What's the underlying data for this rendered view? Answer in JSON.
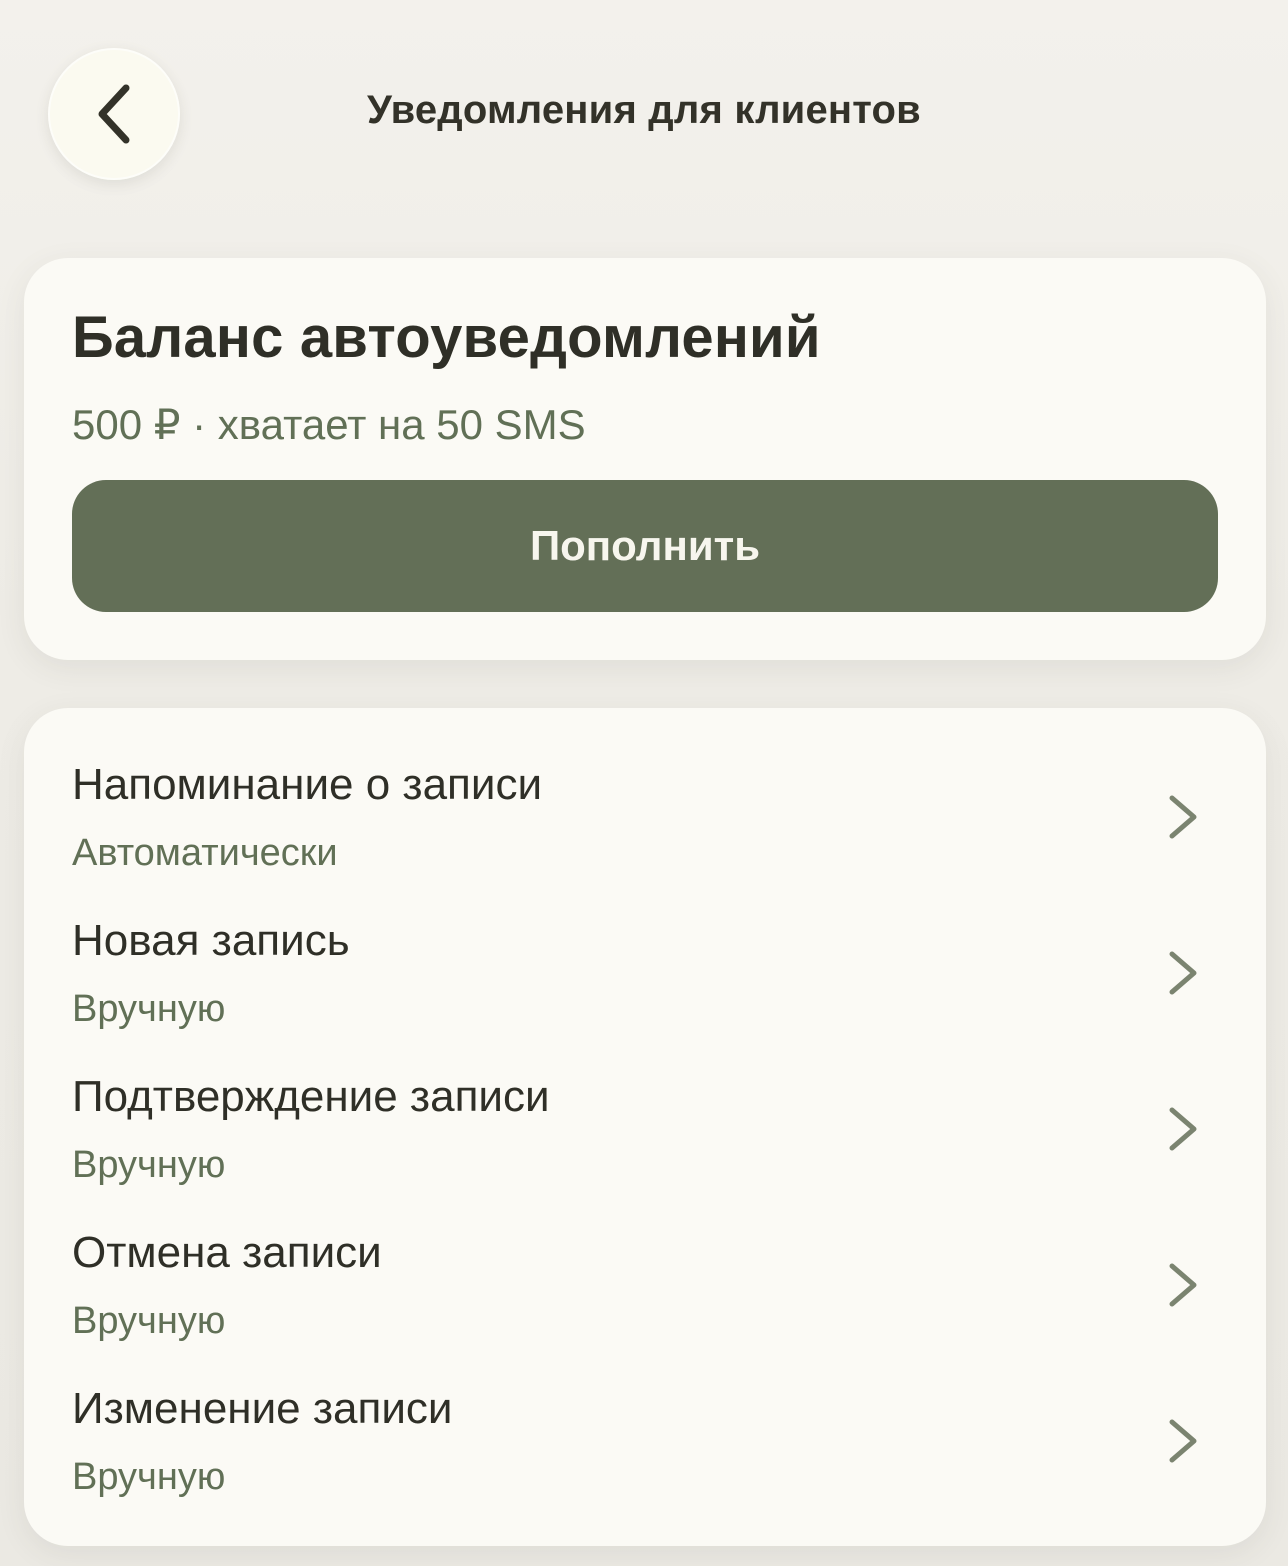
{
  "header": {
    "title": "Уведомления для клиентов",
    "back_icon": "chevron-left-icon"
  },
  "balance": {
    "title": "Баланс автоуведомлений",
    "subtitle": "500 ₽ · хватает на 50 SMS",
    "button_label": "Пополнить"
  },
  "notifications": [
    {
      "title": "Напоминание о записи",
      "mode": "Автоматически"
    },
    {
      "title": "Новая запись",
      "mode": "Вручную"
    },
    {
      "title": "Подтверждение записи",
      "mode": "Вручную"
    },
    {
      "title": "Отмена записи",
      "mode": "Вручную"
    },
    {
      "title": "Изменение записи",
      "mode": "Вручную"
    }
  ],
  "colors": {
    "background": "#f2f0ea",
    "card": "#fbfaf5",
    "accent": "#636f57",
    "secondary_text": "#617056",
    "primary_text": "#2f2f27"
  }
}
